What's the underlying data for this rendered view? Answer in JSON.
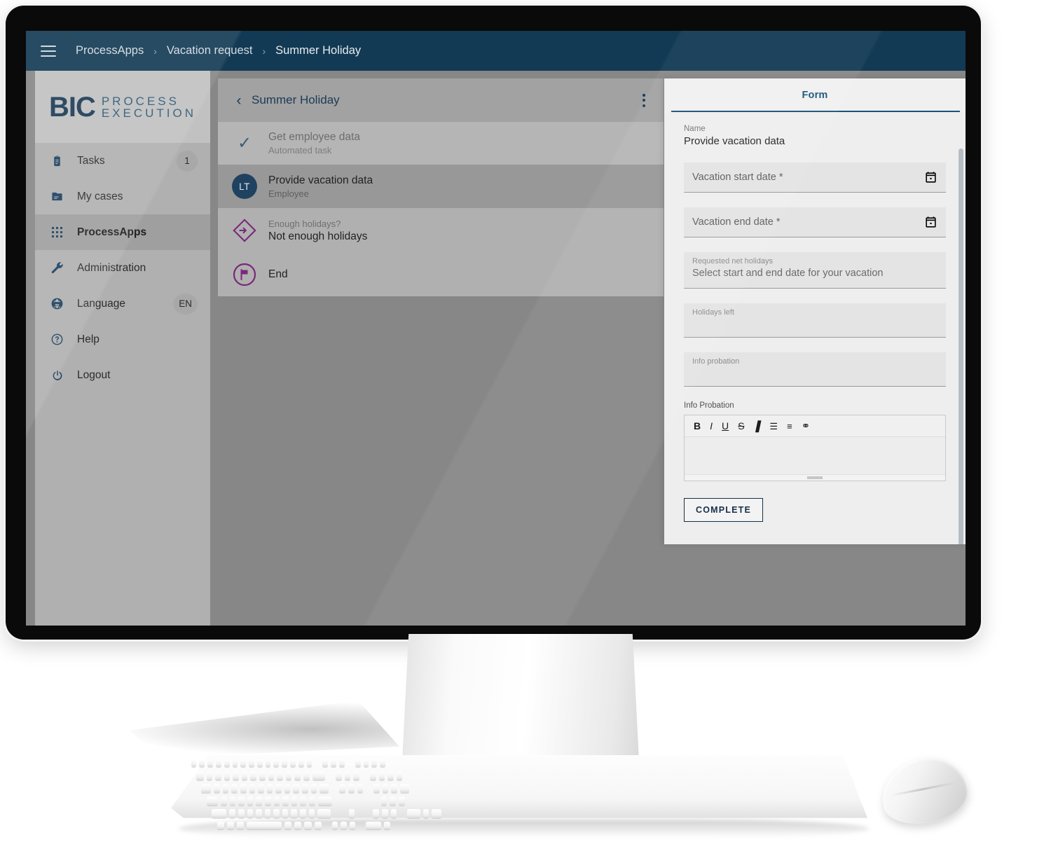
{
  "topbar": {
    "menu_icon": "hamburger-icon",
    "breadcrumbs": [
      {
        "label": "ProcessApps"
      },
      {
        "label": "Vacation request"
      },
      {
        "label": "Summer Holiday"
      }
    ],
    "separator": "›",
    "background_color": "#123a54"
  },
  "sidebar": {
    "logo": {
      "mark": "BIC",
      "line1": "PROCESS",
      "line2": "EXECUTION"
    },
    "items": [
      {
        "label": "Tasks",
        "icon": "clipboard-icon",
        "badge": "1",
        "active": false
      },
      {
        "label": "My cases",
        "icon": "folder-icon",
        "badge": "",
        "active": false
      },
      {
        "label": "ProcessApps",
        "icon": "grid-icon",
        "badge": "",
        "active": true
      },
      {
        "label": "Administration",
        "icon": "wrench-icon",
        "badge": "",
        "active": false
      },
      {
        "label": "Language",
        "icon": "globe-icon",
        "badge": "EN",
        "active": false
      },
      {
        "label": "Help",
        "icon": "question-icon",
        "badge": "",
        "active": false
      },
      {
        "label": "Logout",
        "icon": "power-icon",
        "badge": "",
        "active": false
      }
    ]
  },
  "process": {
    "title": "Summer Holiday",
    "back_icon": "chevron-left-icon",
    "menu_icon": "kebab-menu-icon",
    "steps": [
      {
        "icon": "check-icon",
        "primary": "Get employee data",
        "secondary": "Automated task",
        "state": "done"
      },
      {
        "icon": "avatar",
        "avatar_initials": "LT",
        "primary": "Provide vacation data",
        "secondary": "Employee",
        "state": "current"
      },
      {
        "icon": "gateway-icon",
        "label": "Enough holidays?",
        "primary": "Not enough holidays",
        "secondary": "",
        "state": "grouped"
      },
      {
        "icon": "end-event-icon",
        "primary": "End",
        "secondary": "",
        "state": "grouped"
      }
    ]
  },
  "form": {
    "tab_label": "Form",
    "name_label": "Name",
    "name_value": "Provide vacation data",
    "fields": [
      {
        "type": "date",
        "placeholder": "Vacation start date *",
        "icon": "calendar-icon"
      },
      {
        "type": "date",
        "placeholder": "Vacation end date *",
        "icon": "calendar-icon"
      },
      {
        "type": "stack",
        "label": "Requested net holidays",
        "value": "Select start and end date for your vacation"
      },
      {
        "type": "stack",
        "label": "Holidays left",
        "value": ""
      },
      {
        "type": "stack",
        "label": "Info probation",
        "value": ""
      }
    ],
    "rich_text": {
      "caption": "Info Probation",
      "toolbar": [
        {
          "glyph": "B",
          "name": "bold-icon"
        },
        {
          "glyph": "I",
          "name": "italic-icon"
        },
        {
          "glyph": "U",
          "name": "underline-icon"
        },
        {
          "glyph": "S",
          "name": "strikethrough-icon"
        },
        {
          "glyph": "▐",
          "name": "highlight-icon"
        },
        {
          "glyph": "☰",
          "name": "bullet-list-icon"
        },
        {
          "glyph": "≡",
          "name": "numbered-list-icon"
        },
        {
          "glyph": "⚭",
          "name": "link-icon"
        }
      ],
      "content": ""
    },
    "submit_label": "COMPLETE",
    "accent_color": "#1b5378"
  }
}
